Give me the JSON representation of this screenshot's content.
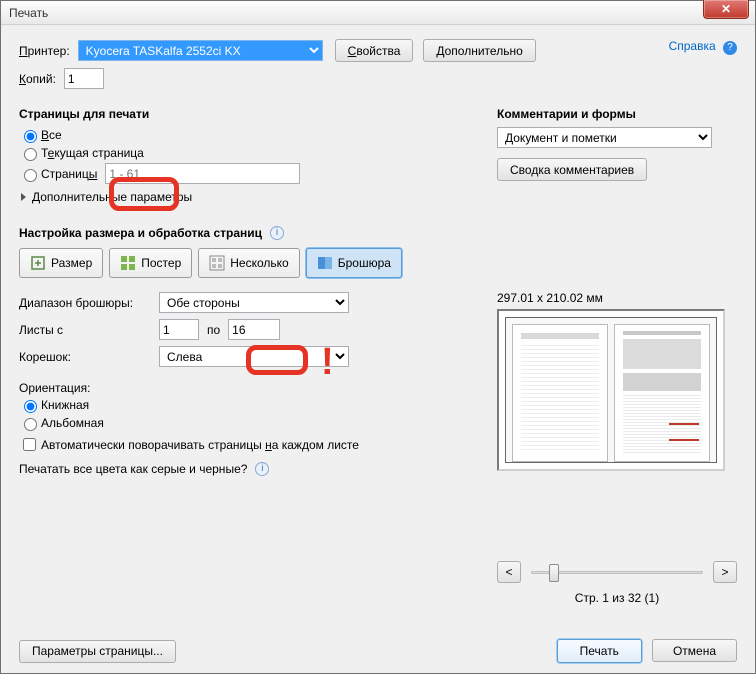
{
  "window": {
    "title": "Печать"
  },
  "header": {
    "printer_label": "Принтер:",
    "printer_selected": "Kyocera TASKalfa 2552ci KX",
    "properties_btn": "Свойства",
    "advanced_btn": "Дополнительно",
    "help_link": "Справка",
    "copies_label": "Копий:",
    "copies_value": "1"
  },
  "pages": {
    "heading": "Страницы для печати",
    "all": "Все",
    "current": "Текущая страница",
    "range_label": "Страницы",
    "range_placeholder": "1 - 61",
    "more_options": "Дополнительные параметры"
  },
  "comments": {
    "heading": "Комментарии и формы",
    "selected": "Документ и пометки",
    "summary_btn": "Сводка комментариев"
  },
  "sizing": {
    "heading": "Настройка размера и обработка страниц",
    "size_btn": "Размер",
    "poster_btn": "Постер",
    "multiple_btn": "Несколько",
    "booklet_btn": "Брошюра"
  },
  "booklet": {
    "subset_label": "Диапазон брошюры:",
    "subset_value": "Обе стороны",
    "sheets_from_label": "Листы с",
    "sheets_from": "1",
    "sheets_to_label": "по",
    "sheets_to": "16",
    "binding_label": "Корешок:",
    "binding_value": "Слева"
  },
  "orientation": {
    "heading": "Ориентация:",
    "portrait": "Книжная",
    "landscape": "Альбомная",
    "auto_rotate": "Автоматически поворачивать страницы на каждом листе",
    "grayscale_question": "Печатать все цвета как серые и черные?"
  },
  "preview": {
    "dimensions": "297.01 x 210.02 мм",
    "page_indicator": "Стр. 1 из 32 (1)"
  },
  "footer": {
    "page_setup": "Параметры страницы...",
    "print": "Печать",
    "cancel": "Отмена"
  }
}
